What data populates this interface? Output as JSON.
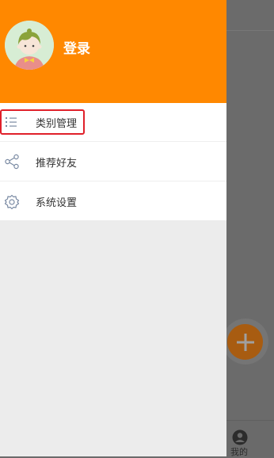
{
  "colors": {
    "header": "#ff8800",
    "overlay": "#6b6b6b",
    "highlight": "#e0202a",
    "fab": "#a85c11"
  },
  "drawer": {
    "login_label": "登录",
    "avatar_icon": "user-avatar-illustration",
    "menu": [
      {
        "icon": "list-icon",
        "label": "类别管理"
      },
      {
        "icon": "share-icon",
        "label": "推荐好友"
      },
      {
        "icon": "gear-icon",
        "label": "系统设置"
      }
    ]
  },
  "background": {
    "fab_icon": "plus-icon",
    "bottom_tab": {
      "icon": "person-icon",
      "label": "我的"
    }
  }
}
